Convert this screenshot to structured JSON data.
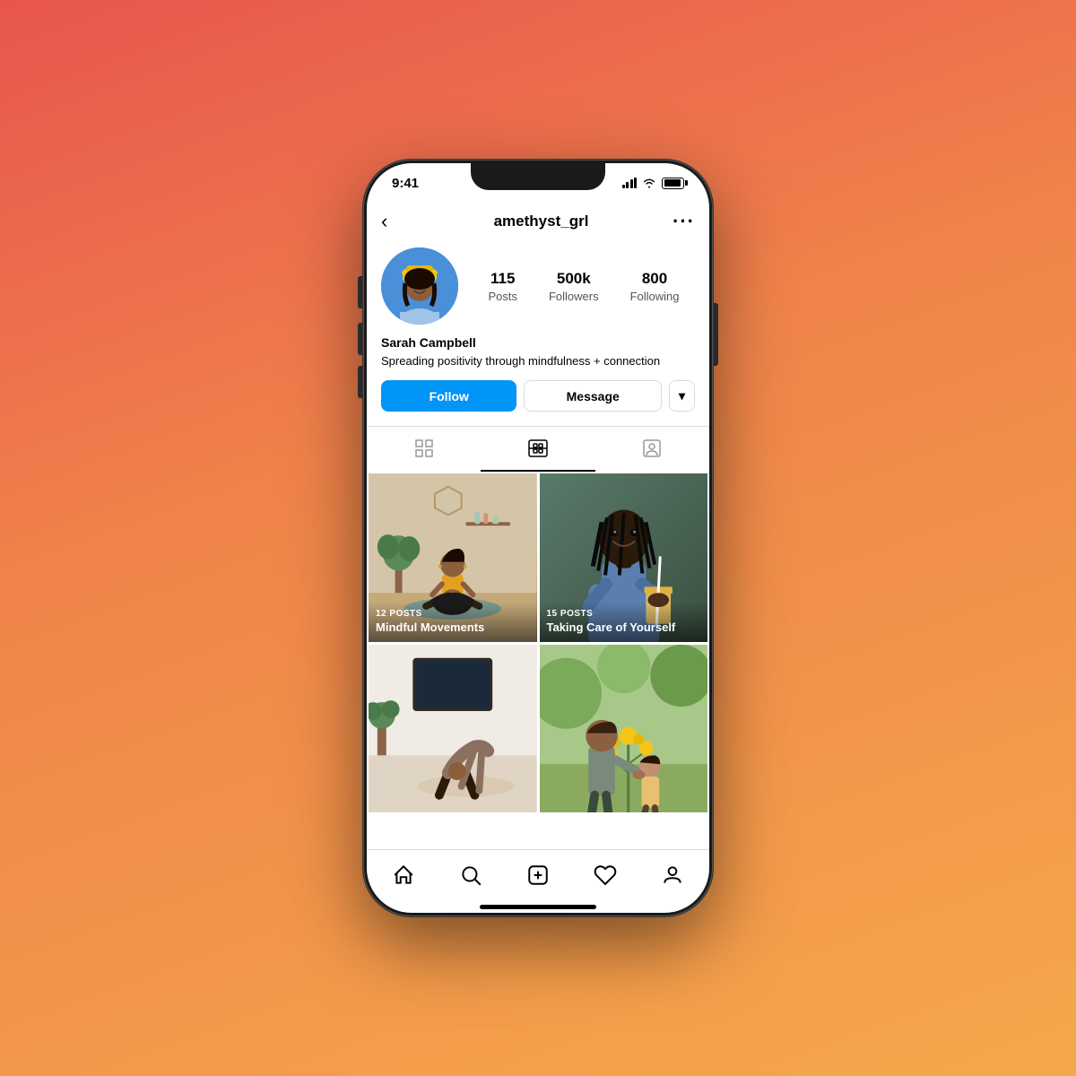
{
  "background": "linear-gradient(160deg, #e8554e 0%, #f0834a 40%, #f5a84a 100%)",
  "statusBar": {
    "time": "9:41",
    "signal": "full",
    "wifi": true,
    "battery": 90
  },
  "header": {
    "backLabel": "‹",
    "username": "amethyst_grl",
    "moreLabel": "···"
  },
  "profile": {
    "avatarAlt": "Sarah Campbell profile photo",
    "stats": [
      {
        "number": "115",
        "label": "Posts"
      },
      {
        "number": "500k",
        "label": "Followers"
      },
      {
        "number": "800",
        "label": "Following"
      }
    ],
    "name": "Sarah Campbell",
    "bio": "Spreading positivity through mindfulness + connection"
  },
  "actions": {
    "followLabel": "Follow",
    "messageLabel": "Message",
    "dropdownArrow": "▾"
  },
  "tabs": [
    {
      "id": "grid",
      "icon": "⊞",
      "label": "Grid",
      "active": false
    },
    {
      "id": "reels",
      "icon": "▦",
      "label": "Reels",
      "active": true
    },
    {
      "id": "tagged",
      "icon": "👤",
      "label": "Tagged",
      "active": false
    }
  ],
  "posts": [
    {
      "id": "post1",
      "type": "reel",
      "postsCount": "12 POSTS",
      "title": "Mindful Movements",
      "colorClass": "photo-yoga"
    },
    {
      "id": "post2",
      "type": "reel",
      "postsCount": "15 POSTS",
      "title": "Taking Care of Yourself",
      "colorClass": "photo-drink"
    },
    {
      "id": "post3",
      "type": "plain",
      "colorClass": "photo-pose"
    },
    {
      "id": "post4",
      "type": "plain",
      "colorClass": "photo-garden"
    }
  ],
  "bottomNav": [
    {
      "id": "home",
      "icon": "⌂",
      "label": "Home"
    },
    {
      "id": "search",
      "icon": "⌕",
      "label": "Search"
    },
    {
      "id": "add",
      "icon": "⊕",
      "label": "Add"
    },
    {
      "id": "likes",
      "icon": "♡",
      "label": "Likes"
    },
    {
      "id": "profile",
      "icon": "◯",
      "label": "Profile"
    }
  ]
}
